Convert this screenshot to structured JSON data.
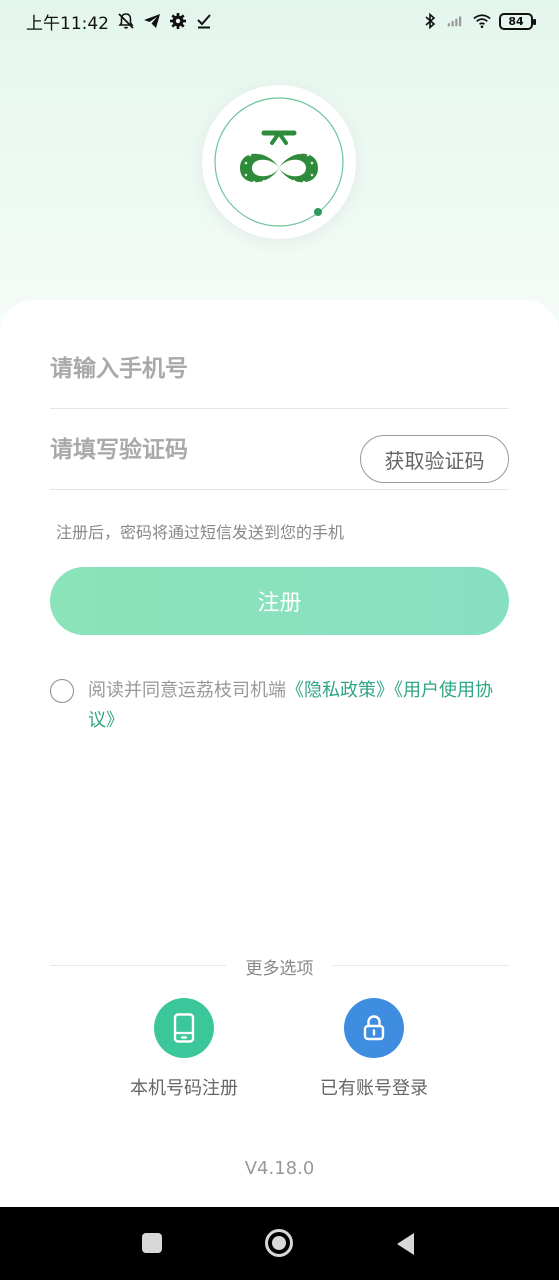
{
  "status_bar": {
    "time": "上午11:42",
    "battery": "84",
    "icons": [
      "mute-icon",
      "telegram-icon",
      "gear-icon",
      "check-icon",
      "bluetooth-icon",
      "signal-icon",
      "wifi-icon"
    ]
  },
  "logo": {
    "icon": "bicycle-logo-icon",
    "color": "#2e8b3a"
  },
  "form": {
    "phone_placeholder": "请输入手机号",
    "code_placeholder": "请填写验证码",
    "get_code_label": "获取验证码",
    "hint": "注册后，密码将通过短信发送到您的手机",
    "register_label": "注册"
  },
  "agreement": {
    "prefix": "阅读并同意运荔枝司机端",
    "privacy_link": "《隐私政策》",
    "terms_link": "《用户使用协议》"
  },
  "more_options": {
    "title": "更多选项",
    "local_register": "本机号码注册",
    "account_login": "已有账号登录"
  },
  "version": "V4.18.0",
  "colors": {
    "accent": "#2fa684",
    "register_button": "#8be3b9",
    "local_register_circle": "#3cc79a",
    "account_login_circle": "#3e8de0"
  }
}
